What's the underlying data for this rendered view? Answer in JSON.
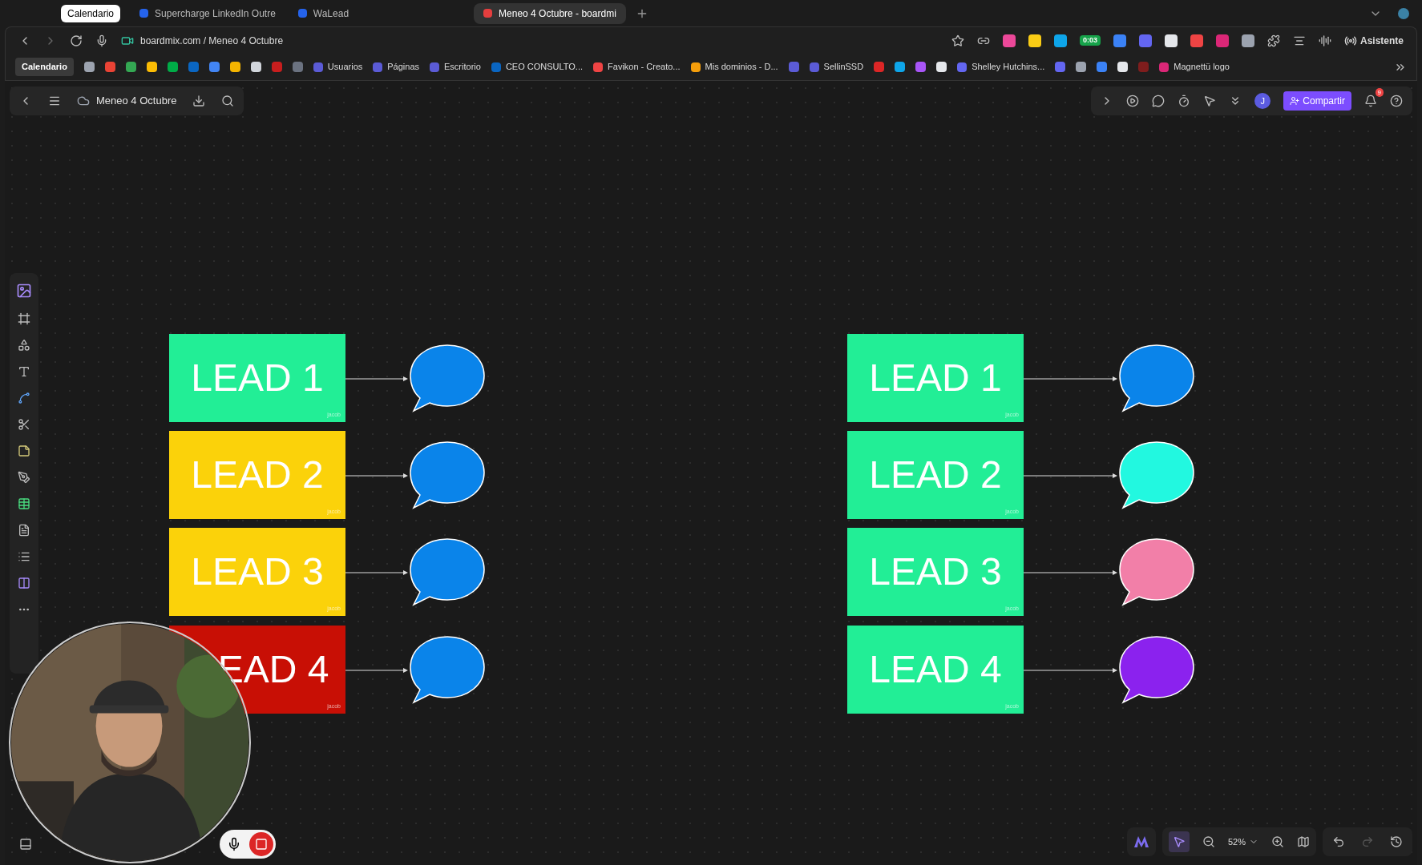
{
  "browser": {
    "tabs": [
      {
        "label": "Calendario",
        "kind": "pill",
        "selected": false
      },
      {
        "label": "Supercharge LinkedIn Outre",
        "kind": "page",
        "selected": false
      },
      {
        "label": "WaLead",
        "kind": "page",
        "selected": false
      },
      {
        "label": "Meneo 4 Octubre - boardmi",
        "kind": "page",
        "selected": true
      }
    ],
    "address": "boardmix.com / Meneo 4 Octubre",
    "extension_badge": "0:03",
    "assistant": "Asistente",
    "bookmarks": [
      {
        "kind": "pill",
        "label": "Calendario"
      },
      {
        "kind": "icon",
        "color": "#9ca3af"
      },
      {
        "kind": "icon",
        "color": "#ea4335"
      },
      {
        "kind": "icon",
        "color": "#34a853"
      },
      {
        "kind": "icon",
        "color": "#fbbc04"
      },
      {
        "kind": "icon",
        "color": "#00ac47"
      },
      {
        "kind": "icon",
        "color": "#0a66c2"
      },
      {
        "kind": "icon",
        "color": "#4285f4"
      },
      {
        "kind": "icon",
        "color": "#f4b400"
      },
      {
        "kind": "icon",
        "color": "#d1d5db"
      },
      {
        "kind": "icon",
        "color": "#c81e1e"
      },
      {
        "kind": "icon",
        "color": "#6b7280"
      },
      {
        "kind": "link",
        "label": "Usuarios",
        "color": "#5b5bd6"
      },
      {
        "kind": "link",
        "label": "Páginas",
        "color": "#5b5bd6"
      },
      {
        "kind": "link",
        "label": "Escritorio",
        "color": "#5b5bd6"
      },
      {
        "kind": "link",
        "label": "CEO CONSULTO...",
        "color": "#0a66c2"
      },
      {
        "kind": "link",
        "label": "Favikon - Creato...",
        "color": "#ef4444"
      },
      {
        "kind": "link",
        "label": "Mis dominios - D...",
        "color": "#f59e0b"
      },
      {
        "kind": "icon",
        "color": "#5b5bd6"
      },
      {
        "kind": "link",
        "label": "SellinSSD",
        "color": "#5b5bd6"
      },
      {
        "kind": "icon",
        "color": "#dc2626"
      },
      {
        "kind": "icon",
        "color": "#0ea5e9"
      },
      {
        "kind": "icon",
        "color": "#a855f7"
      },
      {
        "kind": "icon",
        "color": "#e5e7eb"
      },
      {
        "kind": "link",
        "label": "Shelley Hutchins...",
        "color": "#6366f1"
      },
      {
        "kind": "icon",
        "color": "#6366f1"
      },
      {
        "kind": "icon",
        "color": "#9ca3af"
      },
      {
        "kind": "icon",
        "color": "#3b82f6"
      },
      {
        "kind": "icon",
        "color": "#e5e7eb"
      },
      {
        "kind": "icon",
        "color": "#7f1d1d"
      },
      {
        "kind": "link",
        "label": "Magnettü logo",
        "color": "#db2777"
      }
    ]
  },
  "app": {
    "board_title": "Meneo 4 Octubre",
    "avatar": "J",
    "share_button": "Compartir",
    "notification_count": "9",
    "zoom": "52%"
  },
  "canvas": {
    "groups": [
      {
        "leads": [
          {
            "label": "LEAD 1",
            "author": "jacob",
            "color": "#22ee96",
            "bubble": {
              "color": "#0a84ea"
            }
          },
          {
            "label": "LEAD 2",
            "author": "jacob",
            "color": "#fbd20a",
            "bubble": {
              "color": "#0a84ea"
            }
          },
          {
            "label": "LEAD 3",
            "author": "jacob",
            "color": "#fbd20a",
            "bubble": {
              "color": "#0a84ea"
            }
          },
          {
            "label": "EAD 4",
            "author": "jacob",
            "color": "#c80f05",
            "bubble": {
              "color": "#0a84ea"
            }
          }
        ]
      },
      {
        "leads": [
          {
            "label": "LEAD 1",
            "author": "jacob",
            "color": "#22ee96",
            "bubble": {
              "color": "#0a84ea"
            }
          },
          {
            "label": "LEAD 2",
            "author": "jacob",
            "color": "#22ee96",
            "bubble": {
              "color": "#22f8e0"
            }
          },
          {
            "label": "LEAD 3",
            "author": "jacob",
            "color": "#22ee96",
            "bubble": {
              "color": "#f27fa8"
            }
          },
          {
            "label": "LEAD 4",
            "author": "jacob",
            "color": "#22ee96",
            "bubble": {
              "color": "#8b22ee"
            }
          }
        ]
      }
    ]
  }
}
